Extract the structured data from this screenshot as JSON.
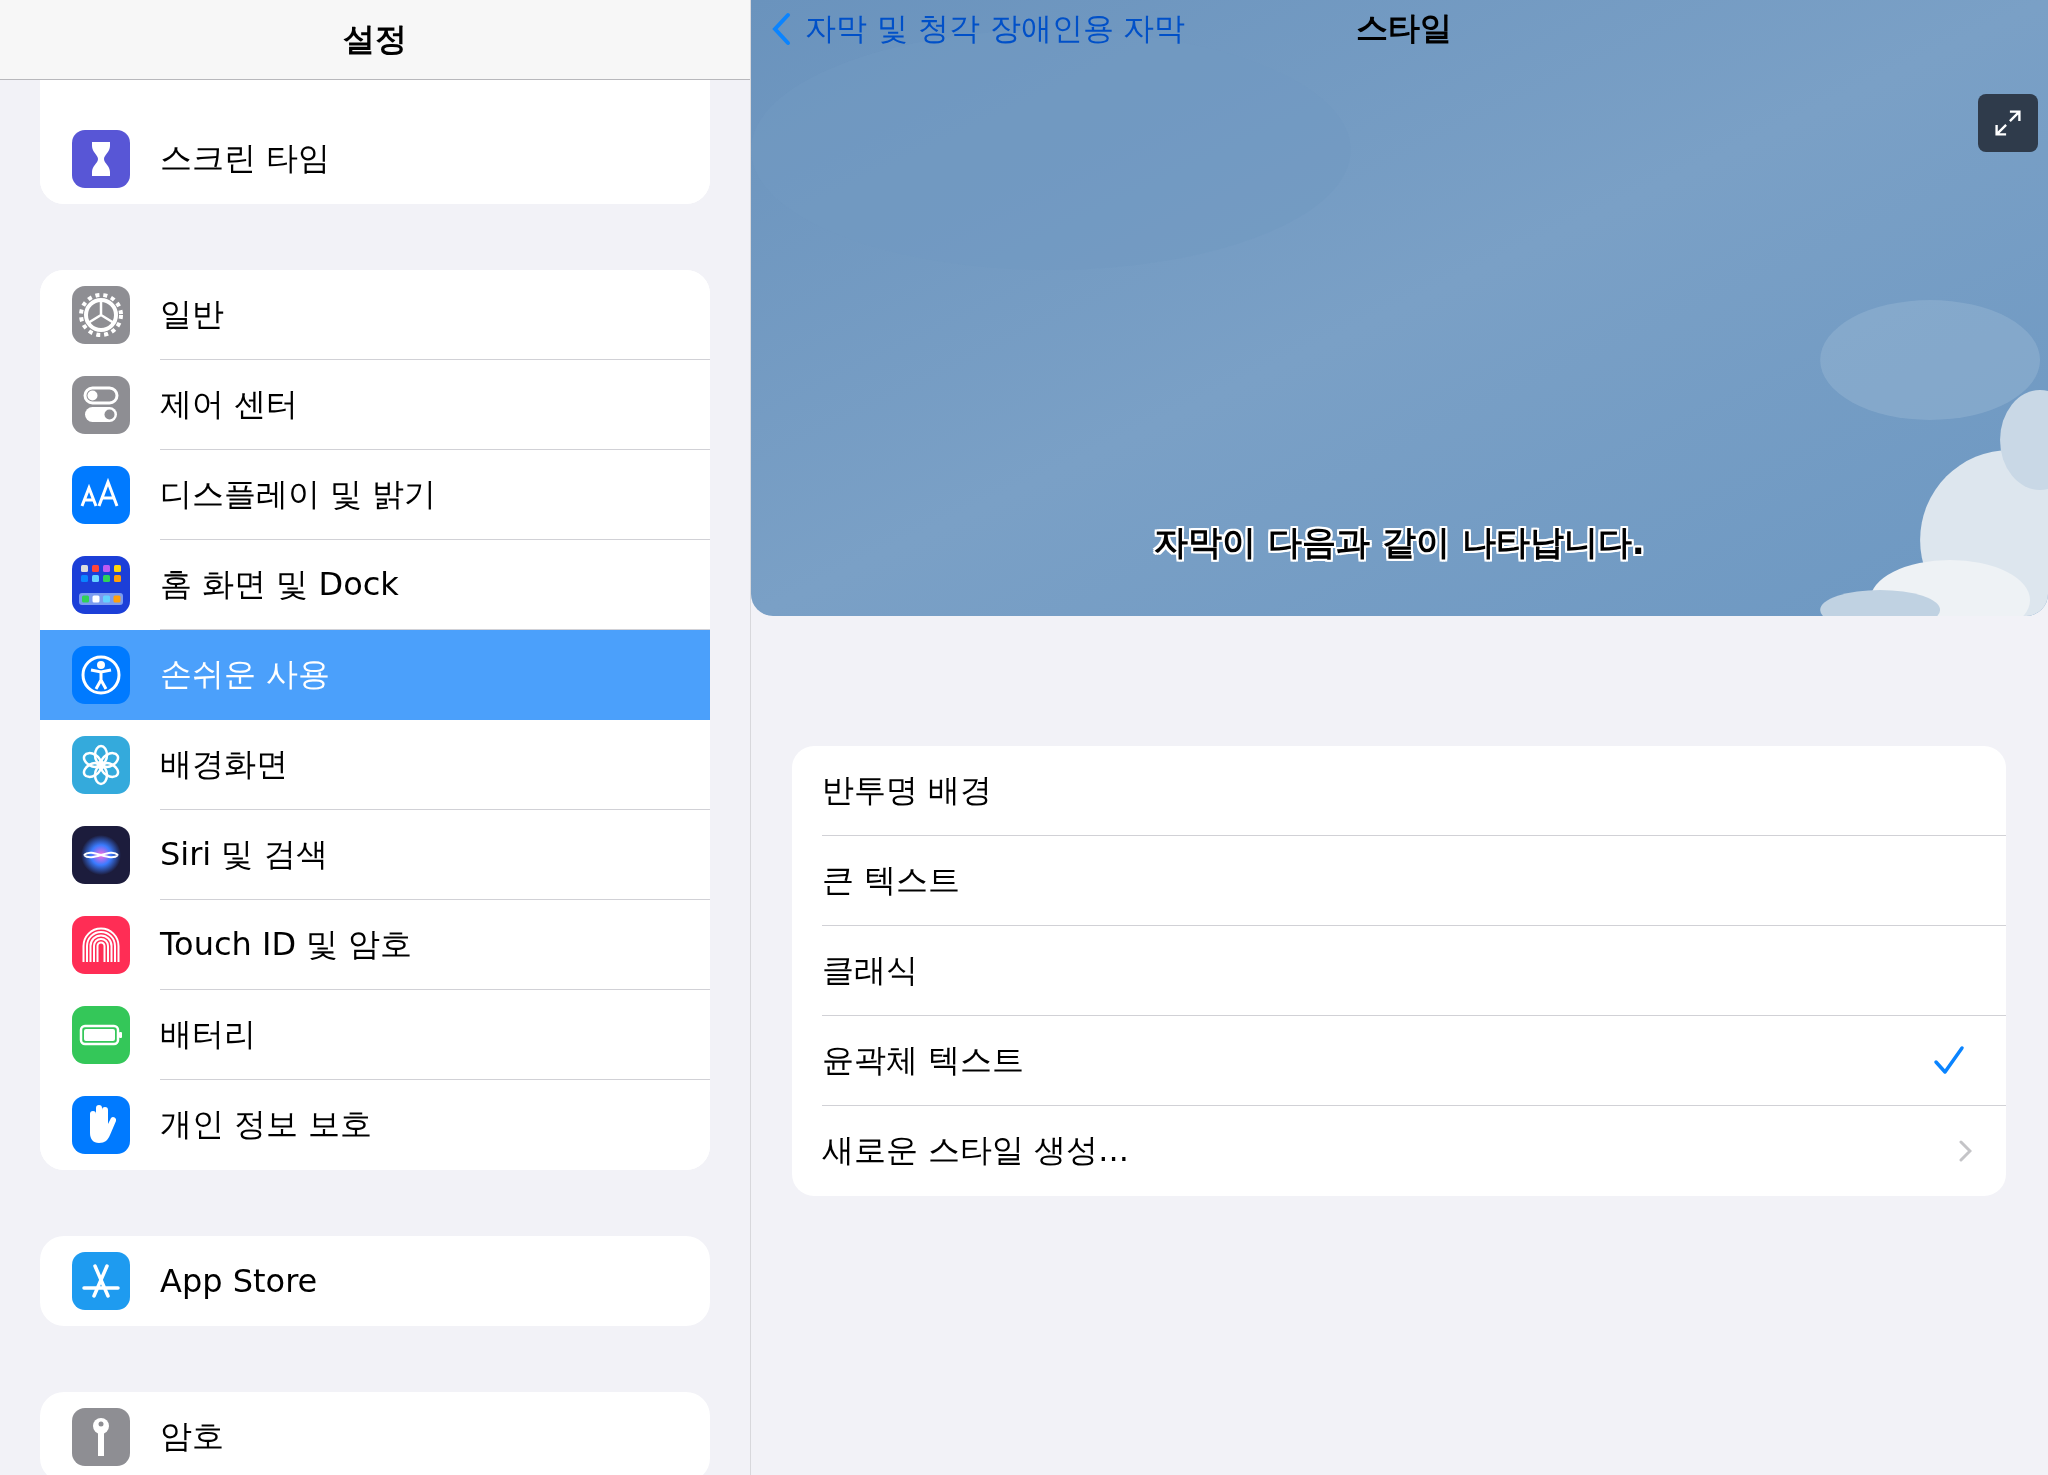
{
  "sidebar": {
    "title": "설정",
    "groups": [
      {
        "items": [
          {
            "label": "스크린 타임",
            "kind": "hourglass",
            "selected": false
          }
        ]
      },
      {
        "items": [
          {
            "label": "일반",
            "kind": "gear",
            "selected": false
          },
          {
            "label": "제어 센터",
            "kind": "toggles",
            "selected": false
          },
          {
            "label": "디스플레이 및 밝기",
            "kind": "display",
            "selected": false
          },
          {
            "label": "홈 화면 및 Dock",
            "kind": "grid",
            "selected": false
          },
          {
            "label": "손쉬운 사용",
            "kind": "accessibility",
            "selected": true
          },
          {
            "label": "배경화면",
            "kind": "flower",
            "selected": false
          },
          {
            "label": "Siri 및 검색",
            "kind": "siri",
            "selected": false
          },
          {
            "label": "Touch ID 및 암호",
            "kind": "fingerprint",
            "selected": false
          },
          {
            "label": "배터리",
            "kind": "battery",
            "selected": false
          },
          {
            "label": "개인 정보 보호",
            "kind": "hand",
            "selected": false
          }
        ]
      },
      {
        "items": [
          {
            "label": "App Store",
            "kind": "appstore",
            "selected": false
          }
        ]
      },
      {
        "items": [
          {
            "label": "암호",
            "kind": "key",
            "selected": false
          }
        ]
      }
    ]
  },
  "detail": {
    "back_label": "자막 및 청각 장애인용 자막",
    "title": "스타일",
    "preview": {
      "caption": "자막이 다음과 같이 나타납니다."
    },
    "options": [
      {
        "label": "반투명 배경",
        "kind": "choice",
        "checked": false
      },
      {
        "label": "큰 텍스트",
        "kind": "choice",
        "checked": false
      },
      {
        "label": "클래식",
        "kind": "choice",
        "checked": false
      },
      {
        "label": "윤곽체 텍스트",
        "kind": "choice",
        "checked": true
      },
      {
        "label": "새로운 스타일 생성...",
        "kind": "link"
      }
    ]
  }
}
